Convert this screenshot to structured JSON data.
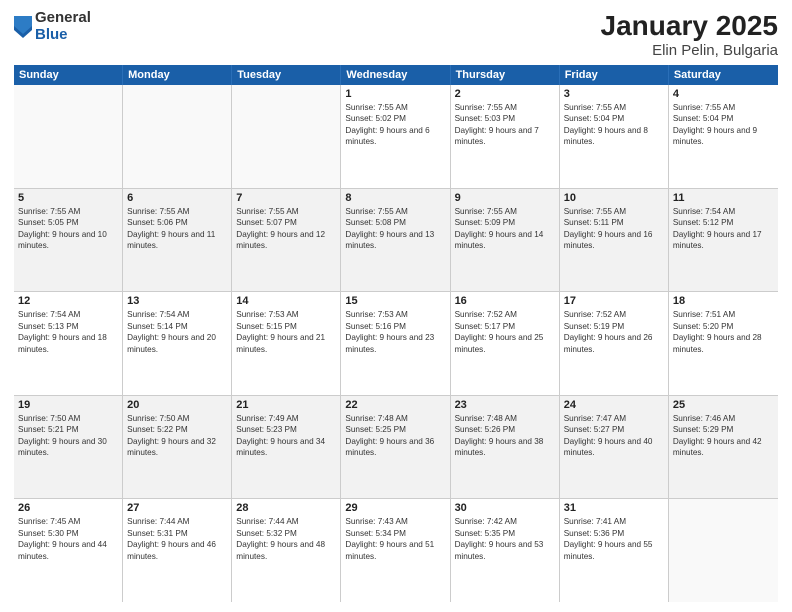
{
  "logo": {
    "general": "General",
    "blue": "Blue"
  },
  "title": "January 2025",
  "subtitle": "Elin Pelin, Bulgaria",
  "weekdays": [
    "Sunday",
    "Monday",
    "Tuesday",
    "Wednesday",
    "Thursday",
    "Friday",
    "Saturday"
  ],
  "weeks": [
    [
      {
        "day": "",
        "sunrise": "",
        "sunset": "",
        "daylight": "",
        "empty": true
      },
      {
        "day": "",
        "sunrise": "",
        "sunset": "",
        "daylight": "",
        "empty": true
      },
      {
        "day": "",
        "sunrise": "",
        "sunset": "",
        "daylight": "",
        "empty": true
      },
      {
        "day": "1",
        "sunrise": "Sunrise: 7:55 AM",
        "sunset": "Sunset: 5:02 PM",
        "daylight": "Daylight: 9 hours and 6 minutes."
      },
      {
        "day": "2",
        "sunrise": "Sunrise: 7:55 AM",
        "sunset": "Sunset: 5:03 PM",
        "daylight": "Daylight: 9 hours and 7 minutes."
      },
      {
        "day": "3",
        "sunrise": "Sunrise: 7:55 AM",
        "sunset": "Sunset: 5:04 PM",
        "daylight": "Daylight: 9 hours and 8 minutes."
      },
      {
        "day": "4",
        "sunrise": "Sunrise: 7:55 AM",
        "sunset": "Sunset: 5:04 PM",
        "daylight": "Daylight: 9 hours and 9 minutes."
      }
    ],
    [
      {
        "day": "5",
        "sunrise": "Sunrise: 7:55 AM",
        "sunset": "Sunset: 5:05 PM",
        "daylight": "Daylight: 9 hours and 10 minutes."
      },
      {
        "day": "6",
        "sunrise": "Sunrise: 7:55 AM",
        "sunset": "Sunset: 5:06 PM",
        "daylight": "Daylight: 9 hours and 11 minutes."
      },
      {
        "day": "7",
        "sunrise": "Sunrise: 7:55 AM",
        "sunset": "Sunset: 5:07 PM",
        "daylight": "Daylight: 9 hours and 12 minutes."
      },
      {
        "day": "8",
        "sunrise": "Sunrise: 7:55 AM",
        "sunset": "Sunset: 5:08 PM",
        "daylight": "Daylight: 9 hours and 13 minutes."
      },
      {
        "day": "9",
        "sunrise": "Sunrise: 7:55 AM",
        "sunset": "Sunset: 5:09 PM",
        "daylight": "Daylight: 9 hours and 14 minutes."
      },
      {
        "day": "10",
        "sunrise": "Sunrise: 7:55 AM",
        "sunset": "Sunset: 5:11 PM",
        "daylight": "Daylight: 9 hours and 16 minutes."
      },
      {
        "day": "11",
        "sunrise": "Sunrise: 7:54 AM",
        "sunset": "Sunset: 5:12 PM",
        "daylight": "Daylight: 9 hours and 17 minutes."
      }
    ],
    [
      {
        "day": "12",
        "sunrise": "Sunrise: 7:54 AM",
        "sunset": "Sunset: 5:13 PM",
        "daylight": "Daylight: 9 hours and 18 minutes."
      },
      {
        "day": "13",
        "sunrise": "Sunrise: 7:54 AM",
        "sunset": "Sunset: 5:14 PM",
        "daylight": "Daylight: 9 hours and 20 minutes."
      },
      {
        "day": "14",
        "sunrise": "Sunrise: 7:53 AM",
        "sunset": "Sunset: 5:15 PM",
        "daylight": "Daylight: 9 hours and 21 minutes."
      },
      {
        "day": "15",
        "sunrise": "Sunrise: 7:53 AM",
        "sunset": "Sunset: 5:16 PM",
        "daylight": "Daylight: 9 hours and 23 minutes."
      },
      {
        "day": "16",
        "sunrise": "Sunrise: 7:52 AM",
        "sunset": "Sunset: 5:17 PM",
        "daylight": "Daylight: 9 hours and 25 minutes."
      },
      {
        "day": "17",
        "sunrise": "Sunrise: 7:52 AM",
        "sunset": "Sunset: 5:19 PM",
        "daylight": "Daylight: 9 hours and 26 minutes."
      },
      {
        "day": "18",
        "sunrise": "Sunrise: 7:51 AM",
        "sunset": "Sunset: 5:20 PM",
        "daylight": "Daylight: 9 hours and 28 minutes."
      }
    ],
    [
      {
        "day": "19",
        "sunrise": "Sunrise: 7:50 AM",
        "sunset": "Sunset: 5:21 PM",
        "daylight": "Daylight: 9 hours and 30 minutes."
      },
      {
        "day": "20",
        "sunrise": "Sunrise: 7:50 AM",
        "sunset": "Sunset: 5:22 PM",
        "daylight": "Daylight: 9 hours and 32 minutes."
      },
      {
        "day": "21",
        "sunrise": "Sunrise: 7:49 AM",
        "sunset": "Sunset: 5:23 PM",
        "daylight": "Daylight: 9 hours and 34 minutes."
      },
      {
        "day": "22",
        "sunrise": "Sunrise: 7:48 AM",
        "sunset": "Sunset: 5:25 PM",
        "daylight": "Daylight: 9 hours and 36 minutes."
      },
      {
        "day": "23",
        "sunrise": "Sunrise: 7:48 AM",
        "sunset": "Sunset: 5:26 PM",
        "daylight": "Daylight: 9 hours and 38 minutes."
      },
      {
        "day": "24",
        "sunrise": "Sunrise: 7:47 AM",
        "sunset": "Sunset: 5:27 PM",
        "daylight": "Daylight: 9 hours and 40 minutes."
      },
      {
        "day": "25",
        "sunrise": "Sunrise: 7:46 AM",
        "sunset": "Sunset: 5:29 PM",
        "daylight": "Daylight: 9 hours and 42 minutes."
      }
    ],
    [
      {
        "day": "26",
        "sunrise": "Sunrise: 7:45 AM",
        "sunset": "Sunset: 5:30 PM",
        "daylight": "Daylight: 9 hours and 44 minutes."
      },
      {
        "day": "27",
        "sunrise": "Sunrise: 7:44 AM",
        "sunset": "Sunset: 5:31 PM",
        "daylight": "Daylight: 9 hours and 46 minutes."
      },
      {
        "day": "28",
        "sunrise": "Sunrise: 7:44 AM",
        "sunset": "Sunset: 5:32 PM",
        "daylight": "Daylight: 9 hours and 48 minutes."
      },
      {
        "day": "29",
        "sunrise": "Sunrise: 7:43 AM",
        "sunset": "Sunset: 5:34 PM",
        "daylight": "Daylight: 9 hours and 51 minutes."
      },
      {
        "day": "30",
        "sunrise": "Sunrise: 7:42 AM",
        "sunset": "Sunset: 5:35 PM",
        "daylight": "Daylight: 9 hours and 53 minutes."
      },
      {
        "day": "31",
        "sunrise": "Sunrise: 7:41 AM",
        "sunset": "Sunset: 5:36 PM",
        "daylight": "Daylight: 9 hours and 55 minutes."
      },
      {
        "day": "",
        "sunrise": "",
        "sunset": "",
        "daylight": "",
        "empty": true
      }
    ]
  ],
  "rowStyles": [
    "row-white",
    "row-gray",
    "row-white",
    "row-gray",
    "row-white"
  ]
}
